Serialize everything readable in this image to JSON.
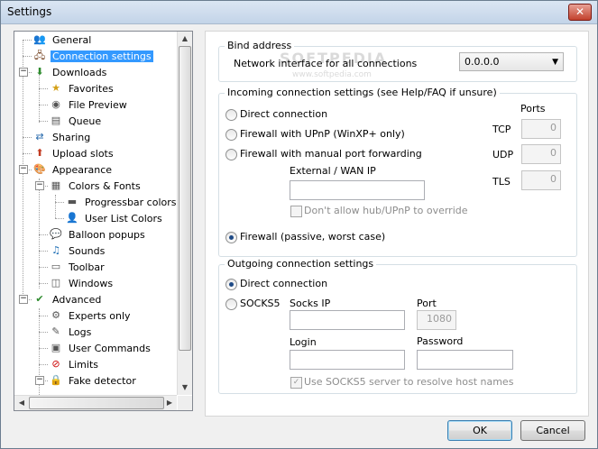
{
  "window": {
    "title": "Settings",
    "close_symbol": "✕"
  },
  "tree": {
    "items": [
      {
        "label": "General",
        "icon": "user-group-icon"
      },
      {
        "label": "Connection settings",
        "icon": "network-icon"
      },
      {
        "label": "Downloads",
        "icon": "download-icon"
      },
      {
        "label": "Favorites",
        "icon": "folder-star-icon"
      },
      {
        "label": "File Preview",
        "icon": "media-icon"
      },
      {
        "label": "Queue",
        "icon": "queue-icon"
      },
      {
        "label": "Sharing",
        "icon": "share-icon"
      },
      {
        "label": "Upload slots",
        "icon": "upload-icon"
      },
      {
        "label": "Appearance",
        "icon": "appearance-icon"
      },
      {
        "label": "Colors & Fonts",
        "icon": "palette-icon"
      },
      {
        "label": "Progressbar colors",
        "icon": "progressbar-icon"
      },
      {
        "label": "User List Colors",
        "icon": "users-icon"
      },
      {
        "label": "Balloon popups",
        "icon": "balloon-icon"
      },
      {
        "label": "Sounds",
        "icon": "music-note-icon"
      },
      {
        "label": "Toolbar",
        "icon": "toolbar-icon"
      },
      {
        "label": "Windows",
        "icon": "windows-icon"
      },
      {
        "label": "Advanced",
        "icon": "advanced-icon"
      },
      {
        "label": "Experts only",
        "icon": "gear-icon"
      },
      {
        "label": "Logs",
        "icon": "pen-icon"
      },
      {
        "label": "User Commands",
        "icon": "command-icon"
      },
      {
        "label": "Limits",
        "icon": "limit-sign-icon"
      },
      {
        "label": "Fake detector",
        "icon": "lock-icon"
      }
    ]
  },
  "bind": {
    "group_title": "Bind address",
    "label": "Network interface for all connections",
    "value": "0.0.0.0"
  },
  "incoming": {
    "group_title": "Incoming connection settings (see Help/FAQ if unsure)",
    "ports_label": "Ports",
    "opt_direct": "Direct connection",
    "opt_upnp": "Firewall with UPnP (WinXP+ only)",
    "opt_manual": "Firewall with manual port forwarding",
    "external_label": "External / WAN IP",
    "external_value": "",
    "dont_allow": "Don't allow hub/UPnP to override",
    "opt_passive": "Firewall (passive, worst case)",
    "tcp_label": "TCP",
    "tcp_value": "0",
    "udp_label": "UDP",
    "udp_value": "0",
    "tls_label": "TLS",
    "tls_value": "0"
  },
  "outgoing": {
    "group_title": "Outgoing connection settings",
    "opt_direct": "Direct connection",
    "opt_socks": "SOCKS5",
    "socks_ip_label": "Socks IP",
    "socks_ip_value": "",
    "port_label": "Port",
    "port_value": "1080",
    "login_label": "Login",
    "login_value": "",
    "password_label": "Password",
    "password_value": "",
    "resolve_label": "Use SOCKS5 server to resolve host names",
    "check_mark": "✓"
  },
  "buttons": {
    "ok": "OK",
    "cancel": "Cancel"
  },
  "watermark": {
    "main": "SOFTPEDIA",
    "sub": "www.softpedia.com"
  }
}
